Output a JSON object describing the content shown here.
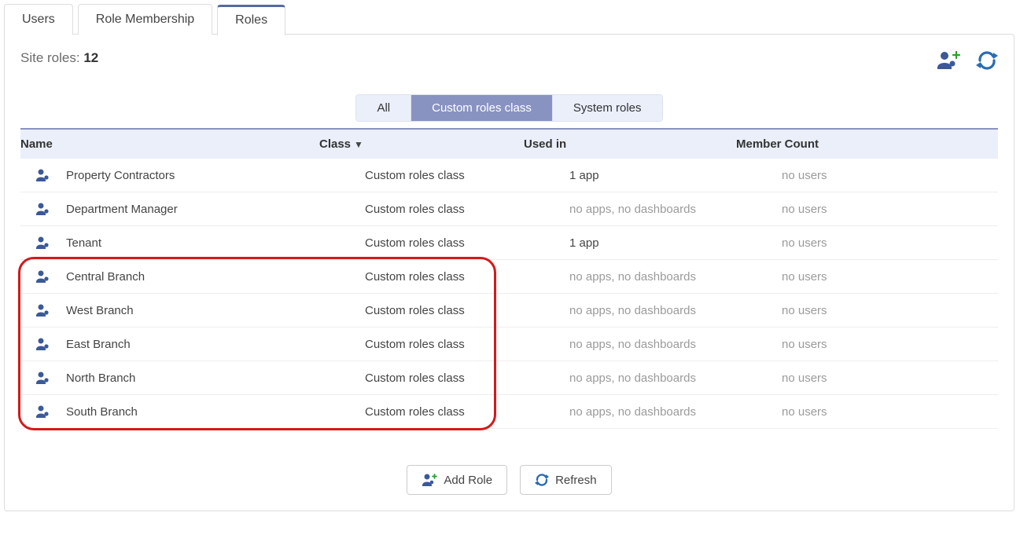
{
  "tabs": [
    "Users",
    "Role Membership",
    "Roles"
  ],
  "active_tab": 2,
  "site_roles_label": "Site roles: ",
  "site_roles_count": "12",
  "filters": [
    "All",
    "Custom roles class",
    "System roles"
  ],
  "active_filter": 1,
  "columns": {
    "name": "Name",
    "class": "Class",
    "used": "Used in",
    "count": "Member Count"
  },
  "sort_indicator": "▼",
  "rows": [
    {
      "name": "Property Contractors",
      "class": "Custom roles class",
      "used": "1 app",
      "used_muted": false,
      "count": "no users"
    },
    {
      "name": "Department Manager",
      "class": "Custom roles class",
      "used": "no apps, no dashboards",
      "used_muted": true,
      "count": "no users"
    },
    {
      "name": "Tenant",
      "class": "Custom roles class",
      "used": "1 app",
      "used_muted": false,
      "count": "no users"
    },
    {
      "name": "Central Branch",
      "class": "Custom roles class",
      "used": "no apps, no dashboards",
      "used_muted": true,
      "count": "no users"
    },
    {
      "name": "West Branch",
      "class": "Custom roles class",
      "used": "no apps, no dashboards",
      "used_muted": true,
      "count": "no users"
    },
    {
      "name": "East Branch",
      "class": "Custom roles class",
      "used": "no apps, no dashboards",
      "used_muted": true,
      "count": "no users"
    },
    {
      "name": "North Branch",
      "class": "Custom roles class",
      "used": "no apps, no dashboards",
      "used_muted": true,
      "count": "no users"
    },
    {
      "name": "South Branch",
      "class": "Custom roles class",
      "used": "no apps, no dashboards",
      "used_muted": true,
      "count": "no users"
    }
  ],
  "highlight_start": 3,
  "highlight_end": 7,
  "footer": {
    "add_role": "Add Role",
    "refresh": "Refresh"
  }
}
